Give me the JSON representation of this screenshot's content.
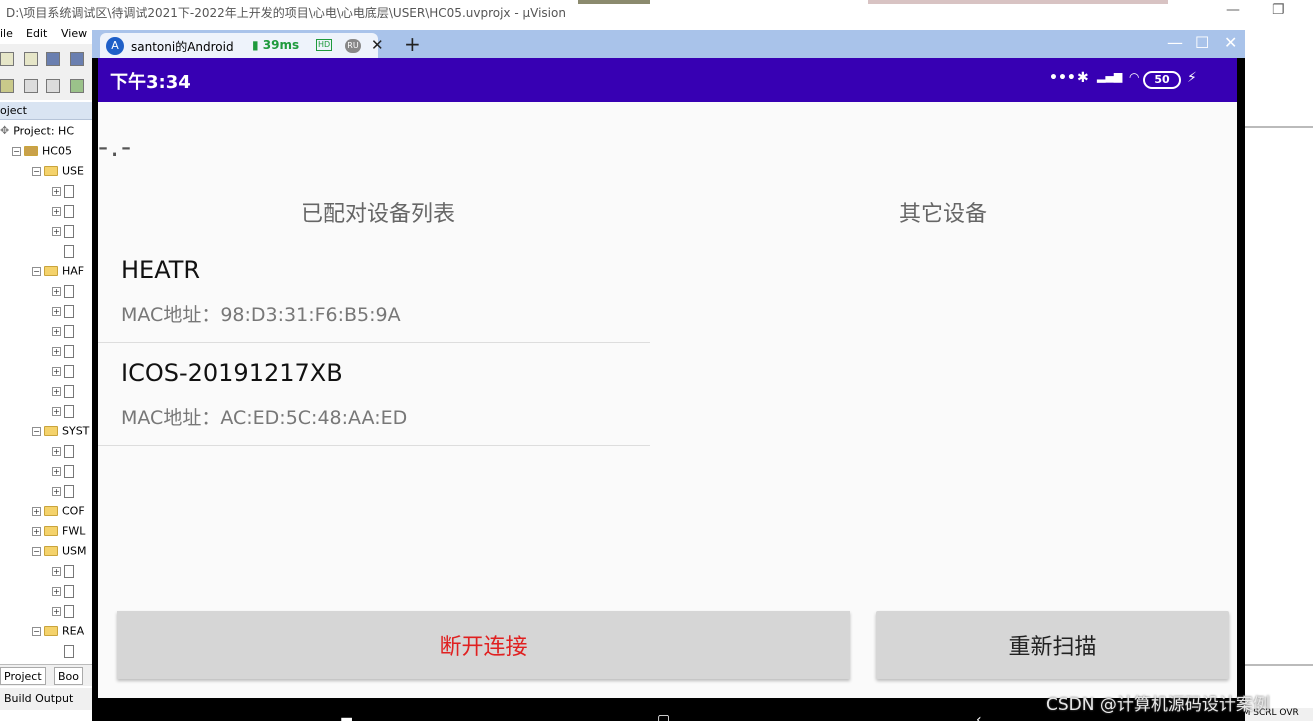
{
  "ide": {
    "title": "D:\\项目系统调试区\\待调试2021下-2022年上开发的项目\\心电\\心电底层\\USER\\HC05.uvprojx - µVision",
    "menu": [
      "ile",
      "Edit",
      "View"
    ],
    "project_header": "oject",
    "tree": [
      {
        "label": "Project: HC",
        "level": 0,
        "type": "root"
      },
      {
        "label": "HC05",
        "level": 1,
        "type": "target"
      },
      {
        "label": "USE",
        "level": 2,
        "type": "folder"
      },
      {
        "label": "",
        "level": 3,
        "type": "file"
      },
      {
        "label": "",
        "level": 3,
        "type": "file"
      },
      {
        "label": "",
        "level": 3,
        "type": "file"
      },
      {
        "label": "",
        "level": 3,
        "type": "file-noexp"
      },
      {
        "label": "HAF",
        "level": 2,
        "type": "folder"
      },
      {
        "label": "",
        "level": 3,
        "type": "file"
      },
      {
        "label": "",
        "level": 3,
        "type": "file"
      },
      {
        "label": "",
        "level": 3,
        "type": "file"
      },
      {
        "label": "",
        "level": 3,
        "type": "file"
      },
      {
        "label": "",
        "level": 3,
        "type": "file"
      },
      {
        "label": "",
        "level": 3,
        "type": "file"
      },
      {
        "label": "",
        "level": 3,
        "type": "file"
      },
      {
        "label": "SYST",
        "level": 2,
        "type": "folder"
      },
      {
        "label": "",
        "level": 3,
        "type": "file"
      },
      {
        "label": "",
        "level": 3,
        "type": "file"
      },
      {
        "label": "",
        "level": 3,
        "type": "file"
      },
      {
        "label": "COF",
        "level": 2,
        "type": "folder-closed"
      },
      {
        "label": "FWL",
        "level": 2,
        "type": "folder-closed"
      },
      {
        "label": "USM",
        "level": 2,
        "type": "folder"
      },
      {
        "label": "",
        "level": 3,
        "type": "file"
      },
      {
        "label": "",
        "level": 3,
        "type": "file"
      },
      {
        "label": "",
        "level": 3,
        "type": "file"
      },
      {
        "label": "REA",
        "level": 2,
        "type": "folder"
      },
      {
        "label": "",
        "level": 3,
        "type": "file-noexp"
      }
    ],
    "tabs": [
      "Project",
      "Boo"
    ],
    "build_output": "Build Output",
    "status_right": "IM  SCRL  OVR"
  },
  "mirror": {
    "tab_title": "santoni的Android",
    "latency": "39ms",
    "hd_badge": "HD",
    "ru_badge": "RU",
    "avatar_letter": "A"
  },
  "phone": {
    "status_time": "下午3:34",
    "battery": "50",
    "app_title": "-.-",
    "paired_header": "已配对设备列表",
    "other_header": "其它设备",
    "devices": [
      {
        "name": "HEATR",
        "mac": "MAC地址：98:D3:31:F6:B5:9A"
      },
      {
        "name": "ICOS-20191217XB",
        "mac": "MAC地址：AC:ED:5C:48:AA:ED"
      }
    ],
    "disconnect_label": "断开连接",
    "rescan_label": "重新扫描"
  },
  "watermark": "CSDN @计算机源码设计案例",
  "colors": {
    "status_bar": "#3700b3",
    "disconnect_text": "#e02020",
    "button_bg": "#d6d6d6",
    "mirror_bar": "#a9c3ea"
  }
}
